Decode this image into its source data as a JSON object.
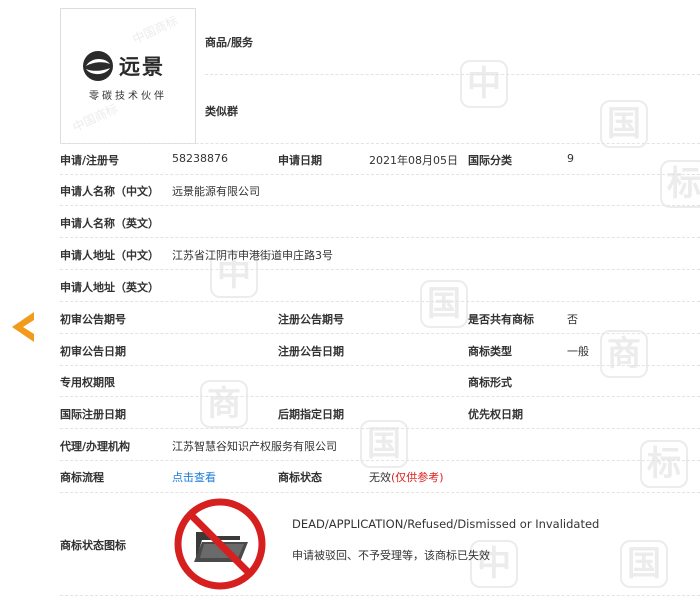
{
  "header": {
    "logo": {
      "brand_name": "远景",
      "slogan": "零碳技术伙伴",
      "watermark": "中国商标"
    },
    "goods_services_label": "商品/服务",
    "similar_group_label": "类似群"
  },
  "fields": {
    "reg_no_label": "申请/注册号",
    "reg_no_value": "58238876",
    "app_date_label": "申请日期",
    "app_date_value": "2021年08月05日",
    "intl_class_label": "国际分类",
    "intl_class_value": "9",
    "applicant_cn_label": "申请人名称（中文）",
    "applicant_cn_value": "远景能源有限公司",
    "applicant_en_label": "申请人名称（英文）",
    "address_cn_label": "申请人地址（中文）",
    "address_cn_value": "江苏省江阴市申港街道申庄路3号",
    "address_en_label": "申请人地址（英文）",
    "prelim_pub_no_label": "初审公告期号",
    "reg_pub_no_label": "注册公告期号",
    "shared_mark_label": "是否共有商标",
    "shared_mark_value": "否",
    "prelim_pub_date_label": "初审公告日期",
    "reg_pub_date_label": "注册公告日期",
    "mark_type_label": "商标类型",
    "mark_type_value": "一般",
    "exclusive_period_label": "专用权期限",
    "mark_form_label": "商标形式",
    "intl_reg_date_label": "国际注册日期",
    "later_designation_label": "后期指定日期",
    "priority_date_label": "优先权日期",
    "agency_label": "代理/办理机构",
    "agency_value": "江苏智慧谷知识产权服务有限公司",
    "flow_label": "商标流程",
    "flow_link": "点击查看",
    "status_label": "商标状态",
    "status_value": "无效",
    "status_note": "(仅供参考)",
    "status_icon_label": "商标状态图标",
    "status_en": "DEAD/APPLICATION/Refused/Dismissed or Invalidated",
    "status_cn": "申请被驳回、不予受理等，该商标已失效"
  },
  "colors": {
    "accent_orange": "#f29a1c",
    "link_blue": "#1a7bd6",
    "invalid_red": "#e02020",
    "status_icon_red": "#d62020"
  },
  "icons": {
    "left_arrow": "chevron-left-icon",
    "status": "folder-prohibited-icon",
    "logo_emblem": "envision-swirl-icon"
  }
}
